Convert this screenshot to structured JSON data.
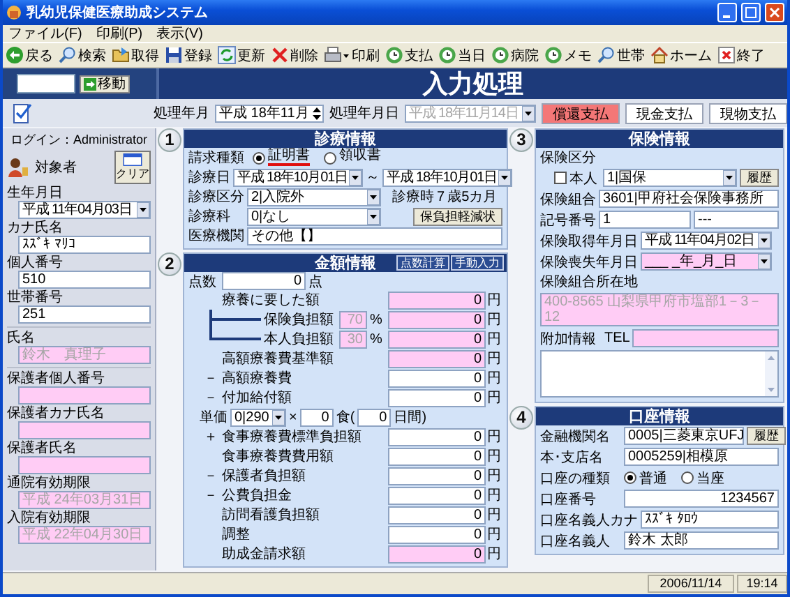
{
  "window": {
    "title": "乳幼児保健医療助成システム"
  },
  "menu": [
    "ファイル(F)",
    "印刷(P)",
    "表示(V)"
  ],
  "toolbar": [
    {
      "kind": "back",
      "label": "戻る"
    },
    {
      "kind": "search",
      "label": "検索"
    },
    {
      "kind": "fetch",
      "label": "取得"
    },
    {
      "kind": "save",
      "label": "登録"
    },
    {
      "kind": "refresh",
      "label": "更新"
    },
    {
      "kind": "delete",
      "label": "削除"
    },
    {
      "kind": "print",
      "label": "印刷"
    },
    {
      "kind": "clock",
      "label": "支払"
    },
    {
      "kind": "clock",
      "label": "当日"
    },
    {
      "kind": "clock",
      "label": "病院"
    },
    {
      "kind": "clock",
      "label": "メモ"
    },
    {
      "kind": "search",
      "label": "世帯"
    },
    {
      "kind": "home",
      "label": "ホーム"
    },
    {
      "kind": "exit",
      "label": "終了"
    }
  ],
  "header": {
    "go_button": "移動",
    "title": "入力処理"
  },
  "period": {
    "month_label": "処理年月",
    "month": "平成 18年11月",
    "date_label": "処理年月日",
    "date": "平成 18年11月14日",
    "date_disabled": true
  },
  "payment_tabs": [
    {
      "label": "償還支払",
      "selected": true
    },
    {
      "label": "現金支払",
      "selected": false
    },
    {
      "label": "現物支払",
      "selected": false
    }
  ],
  "subject": {
    "login": "ログイン：Administrator",
    "label": "対象者",
    "clear_button": "クリア",
    "groups": [
      [
        {
          "label": "生年月日",
          "value": "平成 11年04月03日",
          "kind": "select",
          "highlighted": false,
          "dimmed": false
        },
        {
          "label": "カナ氏名",
          "value": "ｽｽﾞｷ ﾏﾘｺ",
          "kind": "text",
          "highlighted": false,
          "dimmed": false
        },
        {
          "label": "個人番号",
          "value": "510",
          "kind": "text",
          "highlighted": false,
          "dimmed": false
        },
        {
          "label": "世帯番号",
          "value": "251",
          "kind": "text",
          "highlighted": false,
          "dimmed": false
        }
      ],
      [
        {
          "label": "氏名",
          "value": "鈴木　真理子",
          "kind": "text",
          "highlighted": true,
          "dimmed": true
        }
      ],
      [
        {
          "label": "保護者個人番号",
          "kind": "text",
          "highlighted": true
        },
        {
          "label": "保護者カナ氏名",
          "kind": "text",
          "highlighted": true
        },
        {
          "label": "保護者氏名",
          "kind": "text",
          "highlighted": true
        },
        {
          "label": "通院有効期限",
          "value": "平成 24年03月31日",
          "kind": "text",
          "highlighted": true,
          "dimmed": true
        },
        {
          "label": "入院有効期限",
          "value": "平成 22年04月30日",
          "kind": "text",
          "highlighted": true,
          "dimmed": true
        }
      ]
    ]
  },
  "diagnosis": {
    "number": "1",
    "title": "診療情報",
    "claim_label": "請求種類",
    "claim_options": [
      {
        "label": "証明書",
        "selected": true
      },
      {
        "label": "領収書",
        "selected": false
      }
    ],
    "date_label": "診療日",
    "date_from": "平成 18年10月01日",
    "date_sep": "～",
    "date_to": "平成 18年10月01日",
    "category_label": "診療区分",
    "category": "2|入院外",
    "age_label": "診療時",
    "age_years": "7",
    "age_rest": "歳5カ月",
    "dept_label": "診療科",
    "dept": "0|なし",
    "burden_button": "保負担軽減状",
    "institution_label": "医療機関",
    "institution": "その他【】"
  },
  "amounts": {
    "number": "2",
    "title": "金額情報",
    "buttons": [
      "点数計算",
      "手動入力"
    ],
    "points": {
      "label": "点数",
      "value": "0",
      "unit": "点"
    },
    "rows": [
      {
        "kind": "plain",
        "label": "療養に要した額",
        "value": "0",
        "unit": "円",
        "highlighted": true
      },
      {
        "kind": "branch",
        "label": "保険負担額",
        "rate": "70",
        "rate_unit": "%",
        "value": "0",
        "unit": "円",
        "highlighted": true
      },
      {
        "kind": "branch",
        "label": "本人負担額",
        "rate": "30",
        "rate_unit": "%",
        "value": "0",
        "unit": "円",
        "highlighted": true
      },
      {
        "kind": "plain",
        "label": "高額療養費基準額",
        "value": "0",
        "unit": "円",
        "highlighted": true
      },
      {
        "kind": "plain",
        "sign": "－",
        "label": "高額療養費",
        "value": "0",
        "unit": "円",
        "highlighted": false
      },
      {
        "kind": "plain",
        "sign": "－",
        "label": "付加給付額",
        "value": "0",
        "unit": "円",
        "highlighted": false
      },
      {
        "kind": "unit_price",
        "label": "単価",
        "price": "0|290",
        "times": "×",
        "meals": "0",
        "meals_unit": "食(",
        "days": "0",
        "days_unit": "日間)"
      },
      {
        "kind": "plain",
        "sign": "＋",
        "label": "食事療養費標準負担額",
        "value": "0",
        "unit": "円",
        "highlighted": false
      },
      {
        "kind": "plain",
        "label": "食事療養費費用額",
        "value": "0",
        "unit": "円",
        "highlighted": false
      },
      {
        "kind": "plain",
        "sign": "－",
        "label": "保護者負担額",
        "value": "0",
        "unit": "円",
        "highlighted": false
      },
      {
        "kind": "plain",
        "sign": "－",
        "label": "公費負担金",
        "value": "0",
        "unit": "円",
        "highlighted": false
      },
      {
        "kind": "plain",
        "label": "訪問看護負担額",
        "value": "0",
        "unit": "円",
        "highlighted": false
      },
      {
        "kind": "plain",
        "label": "調整",
        "value": "0",
        "unit": "円",
        "highlighted": false
      },
      {
        "kind": "plain",
        "label": "助成金請求額",
        "value": "0",
        "unit": "円",
        "highlighted": true
      }
    ]
  },
  "insurance": {
    "number": "3",
    "title": "保険情報",
    "type_label": "保険区分",
    "self": {
      "label": "本人",
      "checked": false
    },
    "type": "1|国保",
    "history_button": "履歴",
    "union_label": "保険組合",
    "union": "3601|甲府社会保険事務所",
    "code_label": "記号番号",
    "code": "1",
    "code_2": "---",
    "acquired_label": "保険取得年月日",
    "acquired": "平成 11年04月02日",
    "lost_label": "保険喪失年月日",
    "lost": "___ _年_月_日",
    "address_label": "保険組合所在地",
    "address": "400-8565 山梨県甲府市塩部1－3－12",
    "extra_label": "附加情報",
    "tel_label": "TEL"
  },
  "account": {
    "number": "4",
    "title": "口座情報",
    "bank_label": "金融機関名",
    "bank": "0005|三菱東京UFJ",
    "history_button": "履歴",
    "branch_label": "本･支店名",
    "branch": "0005259|相模原",
    "type_label": "口座の種類",
    "types": [
      {
        "label": "普通",
        "selected": true
      },
      {
        "label": "当座",
        "selected": false
      }
    ],
    "number_label": "口座番号",
    "account_number": "1234567",
    "kana_label": "口座名義人カナ",
    "kana": "ｽｽﾞｷ ﾀﾛｳ",
    "holder_label": "口座名義人",
    "holder": "鈴木 太郎"
  },
  "status_bar": {
    "date": "2006/11/14",
    "time": "19:14"
  }
}
